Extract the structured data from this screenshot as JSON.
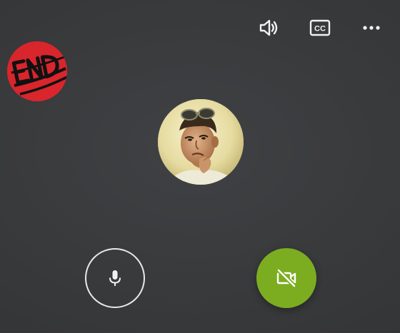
{
  "toolbar": {
    "speaker_icon": "speaker-volume-icon",
    "captions_icon": "closed-captions-icon",
    "captions_label": "CC",
    "more_icon": "more-options-icon"
  },
  "self_view": {
    "logo_text": "END",
    "colors": {
      "background": "#d8262c",
      "ink": "#111111"
    }
  },
  "remote_participant": {
    "avatar": "remote-participant-avatar"
  },
  "controls": {
    "mic_icon": "microphone-icon",
    "video_icon": "video-off-icon",
    "video_button_color": "#7cad21"
  },
  "colors": {
    "background": "#333436",
    "icon": "#f2f2f2"
  }
}
